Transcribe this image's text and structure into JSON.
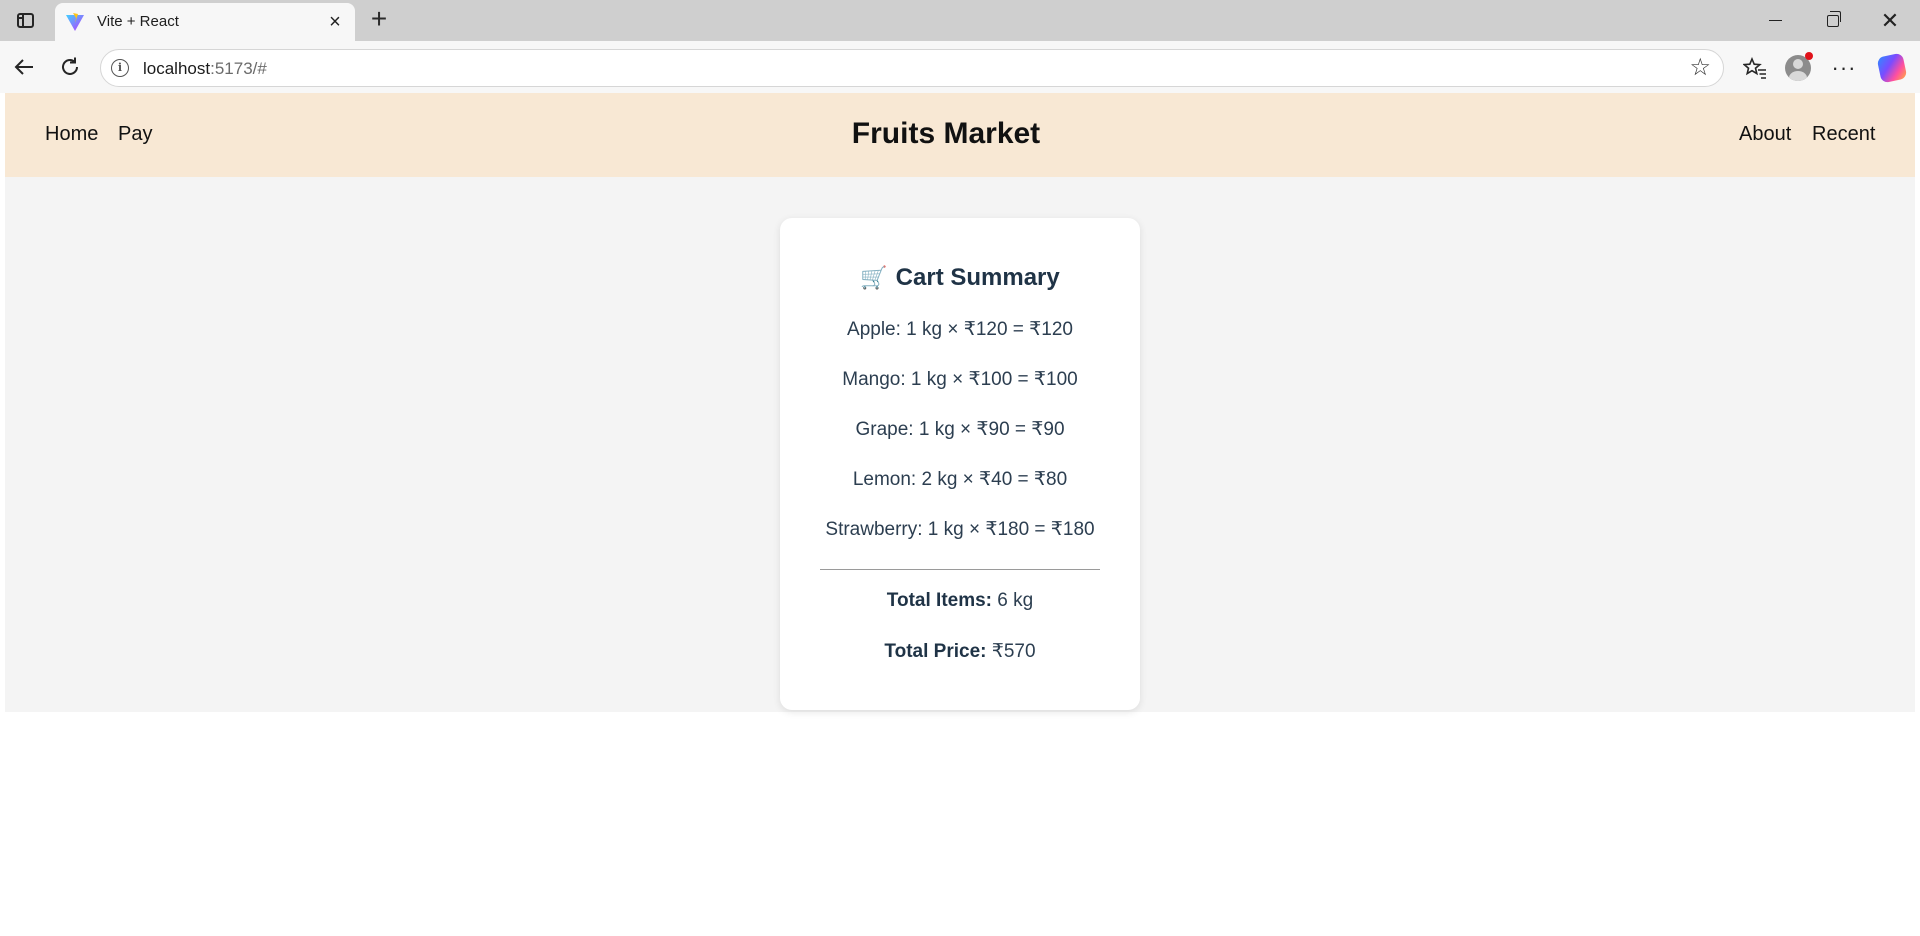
{
  "browser": {
    "tab_title": "Vite + React",
    "url_host": "localhost",
    "url_rest": ":5173/#"
  },
  "header": {
    "nav_left": [
      "Home",
      "Pay"
    ],
    "title": "Fruits Market",
    "nav_right": [
      "About",
      "Recent"
    ],
    "background": "#f8e8d4"
  },
  "cart": {
    "title": "Cart Summary",
    "icon": "shopping-cart-icon",
    "items": [
      "Apple: 1 kg × ₹120 = ₹120",
      "Mango: 1 kg × ₹100 = ₹100",
      "Grape: 1 kg × ₹90 = ₹90",
      "Lemon: 2 kg × ₹40 = ₹80",
      "Strawberry: 1 kg × ₹180 = ₹180"
    ],
    "total_items_label": "Total Items:",
    "total_items_value": "6 kg",
    "total_price_label": "Total Price:",
    "total_price_value": "₹570"
  }
}
